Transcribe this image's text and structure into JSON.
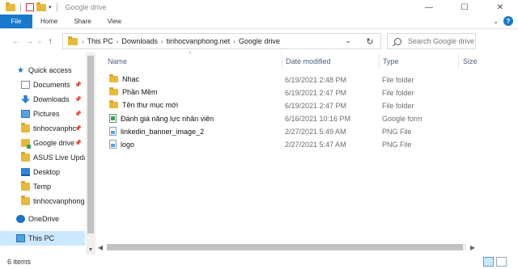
{
  "window": {
    "title": "Google drive",
    "controls": {
      "minimize": "—",
      "maximize": "☐",
      "close": "✕"
    }
  },
  "ribbon": {
    "tabs": [
      "File",
      "Home",
      "Share",
      "View"
    ]
  },
  "address_bar": {
    "crumbs": [
      "This PC",
      "Downloads",
      "tinhocvanphong.net",
      "Google drive"
    ],
    "search_placeholder": "Search Google drive"
  },
  "nav_pane": {
    "quick_access": "Quick access",
    "items": [
      {
        "label": "Documents",
        "pinned": true
      },
      {
        "label": "Downloads",
        "pinned": true
      },
      {
        "label": "Pictures",
        "pinned": true
      },
      {
        "label": "tinhocvanphc",
        "pinned": true
      },
      {
        "label": "Google drive",
        "pinned": true
      },
      {
        "label": "ASUS Live Updat",
        "pinned": false
      },
      {
        "label": "Desktop",
        "pinned": false
      },
      {
        "label": "Temp",
        "pinned": false
      },
      {
        "label": "tinhocvanphong",
        "pinned": false
      }
    ],
    "onedrive": "OneDrive",
    "this_pc": "This PC"
  },
  "columns": {
    "name": "Name",
    "date": "Date modified",
    "type": "Type",
    "size": "Size"
  },
  "files": [
    {
      "name": "Nhạc",
      "date": "6/19/2021 2:48 PM",
      "type": "File folder",
      "icon": "folder-icon"
    },
    {
      "name": "Phần Mềm",
      "date": "6/19/2021 2:47 PM",
      "type": "File folder",
      "icon": "folder-icon"
    },
    {
      "name": "Tên thư mục mới",
      "date": "6/19/2021 2:47 PM",
      "type": "File folder",
      "icon": "folder-icon"
    },
    {
      "name": "Đánh giá năng lực nhân viên",
      "date": "6/16/2021 10:16 PM",
      "type": "Google form",
      "icon": "google-form-icon"
    },
    {
      "name": "linkedin_banner_image_2",
      "date": "2/27/2021 5:49 AM",
      "type": "PNG File",
      "icon": "png-file-icon"
    },
    {
      "name": "logo",
      "date": "2/27/2021 5:47 AM",
      "type": "PNG File",
      "icon": "png-file-icon"
    }
  ],
  "status_bar": {
    "item_count": "6 items"
  },
  "colors": {
    "accent": "#1979ca",
    "selection": "#cce8ff",
    "folder": "#e8b93a"
  }
}
